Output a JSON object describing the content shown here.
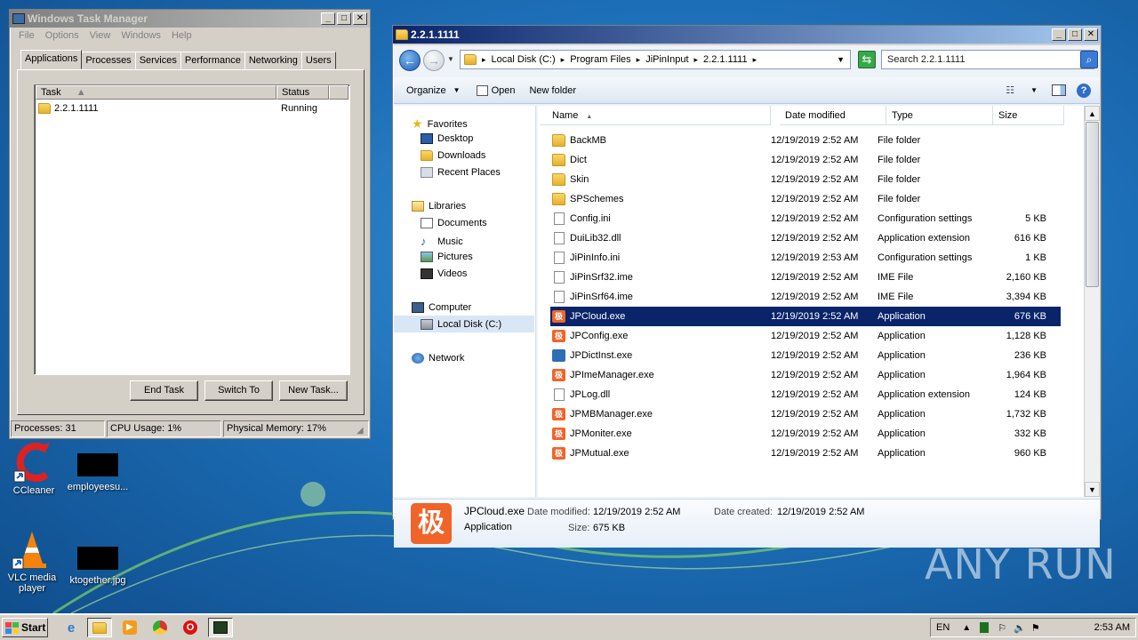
{
  "desktop": {
    "icons": [
      {
        "label": "CCleaner"
      },
      {
        "label": "employeesu..."
      },
      {
        "label": "VLC media player"
      },
      {
        "label": "ktogether.jpg"
      }
    ],
    "watermark": "ANY RUN"
  },
  "task_manager": {
    "title": "Windows Task Manager",
    "menu": [
      "File",
      "Options",
      "View",
      "Windows",
      "Help"
    ],
    "tabs": [
      "Applications",
      "Processes",
      "Services",
      "Performance",
      "Networking",
      "Users"
    ],
    "selected_tab": "Applications",
    "columns": {
      "task": "Task",
      "status": "Status"
    },
    "rows": [
      {
        "task": "2.2.1.1111",
        "status": "Running"
      }
    ],
    "buttons": {
      "end_task": "End Task",
      "switch_to": "Switch To",
      "new_task": "New Task..."
    },
    "status": {
      "processes": "Processes: 31",
      "cpu": "CPU Usage: 1%",
      "memory": "Physical Memory: 17%"
    }
  },
  "explorer": {
    "title": "2.2.1.1111",
    "breadcrumb": [
      "Local Disk (C:)",
      "Program Files",
      "JiPinInput",
      "2.2.1.1111"
    ],
    "search_placeholder": "Search 2.2.1.1111",
    "toolbar": {
      "organize": "Organize",
      "open": "Open",
      "new_folder": "New folder"
    },
    "nav": {
      "favorites": "Favorites",
      "favorites_items": [
        "Desktop",
        "Downloads",
        "Recent Places"
      ],
      "libraries": "Libraries",
      "libraries_items": [
        "Documents",
        "Music",
        "Pictures",
        "Videos"
      ],
      "computer": "Computer",
      "computer_items": [
        "Local Disk (C:)"
      ],
      "network": "Network"
    },
    "columns": {
      "name": "Name",
      "date": "Date modified",
      "type": "Type",
      "size": "Size"
    },
    "files": [
      {
        "name": "BackMB",
        "date": "12/19/2019 2:52 AM",
        "type": "File folder",
        "size": "",
        "icon": "folder-icon"
      },
      {
        "name": "Dict",
        "date": "12/19/2019 2:52 AM",
        "type": "File folder",
        "size": "",
        "icon": "folder-icon"
      },
      {
        "name": "Skin",
        "date": "12/19/2019 2:52 AM",
        "type": "File folder",
        "size": "",
        "icon": "folder-icon"
      },
      {
        "name": "SPSchemes",
        "date": "12/19/2019 2:52 AM",
        "type": "File folder",
        "size": "",
        "icon": "folder-icon"
      },
      {
        "name": "Config.ini",
        "date": "12/19/2019 2:52 AM",
        "type": "Configuration settings",
        "size": "5 KB",
        "icon": "settings-file-icon"
      },
      {
        "name": "DuiLib32.dll",
        "date": "12/19/2019 2:52 AM",
        "type": "Application extension",
        "size": "616 KB",
        "icon": "dll-file-icon"
      },
      {
        "name": "JiPinInfo.ini",
        "date": "12/19/2019 2:53 AM",
        "type": "Configuration settings",
        "size": "1 KB",
        "icon": "settings-file-icon"
      },
      {
        "name": "JiPinSrf32.ime",
        "date": "12/19/2019 2:52 AM",
        "type": "IME File",
        "size": "2,160 KB",
        "icon": "file-icon"
      },
      {
        "name": "JiPinSrf64.ime",
        "date": "12/19/2019 2:52 AM",
        "type": "IME File",
        "size": "3,394 KB",
        "icon": "file-icon"
      },
      {
        "name": "JPCloud.exe",
        "date": "12/19/2019 2:52 AM",
        "type": "Application",
        "size": "676 KB",
        "icon": "jipin-app-icon",
        "selected": true
      },
      {
        "name": "JPConfig.exe",
        "date": "12/19/2019 2:52 AM",
        "type": "Application",
        "size": "1,128 KB",
        "icon": "jipin-app-icon"
      },
      {
        "name": "JPDictInst.exe",
        "date": "12/19/2019 2:52 AM",
        "type": "Application",
        "size": "236 KB",
        "icon": "installer-icon"
      },
      {
        "name": "JPImeManager.exe",
        "date": "12/19/2019 2:52 AM",
        "type": "Application",
        "size": "1,964 KB",
        "icon": "jipin-app-icon"
      },
      {
        "name": "JPLog.dll",
        "date": "12/19/2019 2:52 AM",
        "type": "Application extension",
        "size": "124 KB",
        "icon": "dll-file-icon"
      },
      {
        "name": "JPMBManager.exe",
        "date": "12/19/2019 2:52 AM",
        "type": "Application",
        "size": "1,732 KB",
        "icon": "jipin-app-icon"
      },
      {
        "name": "JPMoniter.exe",
        "date": "12/19/2019 2:52 AM",
        "type": "Application",
        "size": "332 KB",
        "icon": "jipin-app-icon"
      },
      {
        "name": "JPMutual.exe",
        "date": "12/19/2019 2:52 AM",
        "type": "Application",
        "size": "960 KB",
        "icon": "jipin-app-icon"
      }
    ],
    "details": {
      "name": "JPCloud.exe",
      "type": "Application",
      "modified_label": "Date modified:",
      "modified": "12/19/2019 2:52 AM",
      "created_label": "Date created:",
      "created": "12/19/2019 2:52 AM",
      "size_label": "Size:",
      "size": "675 KB",
      "icon_glyph": "极"
    }
  },
  "taskbar": {
    "start": "Start",
    "language": "EN",
    "clock": "2:53 AM"
  }
}
